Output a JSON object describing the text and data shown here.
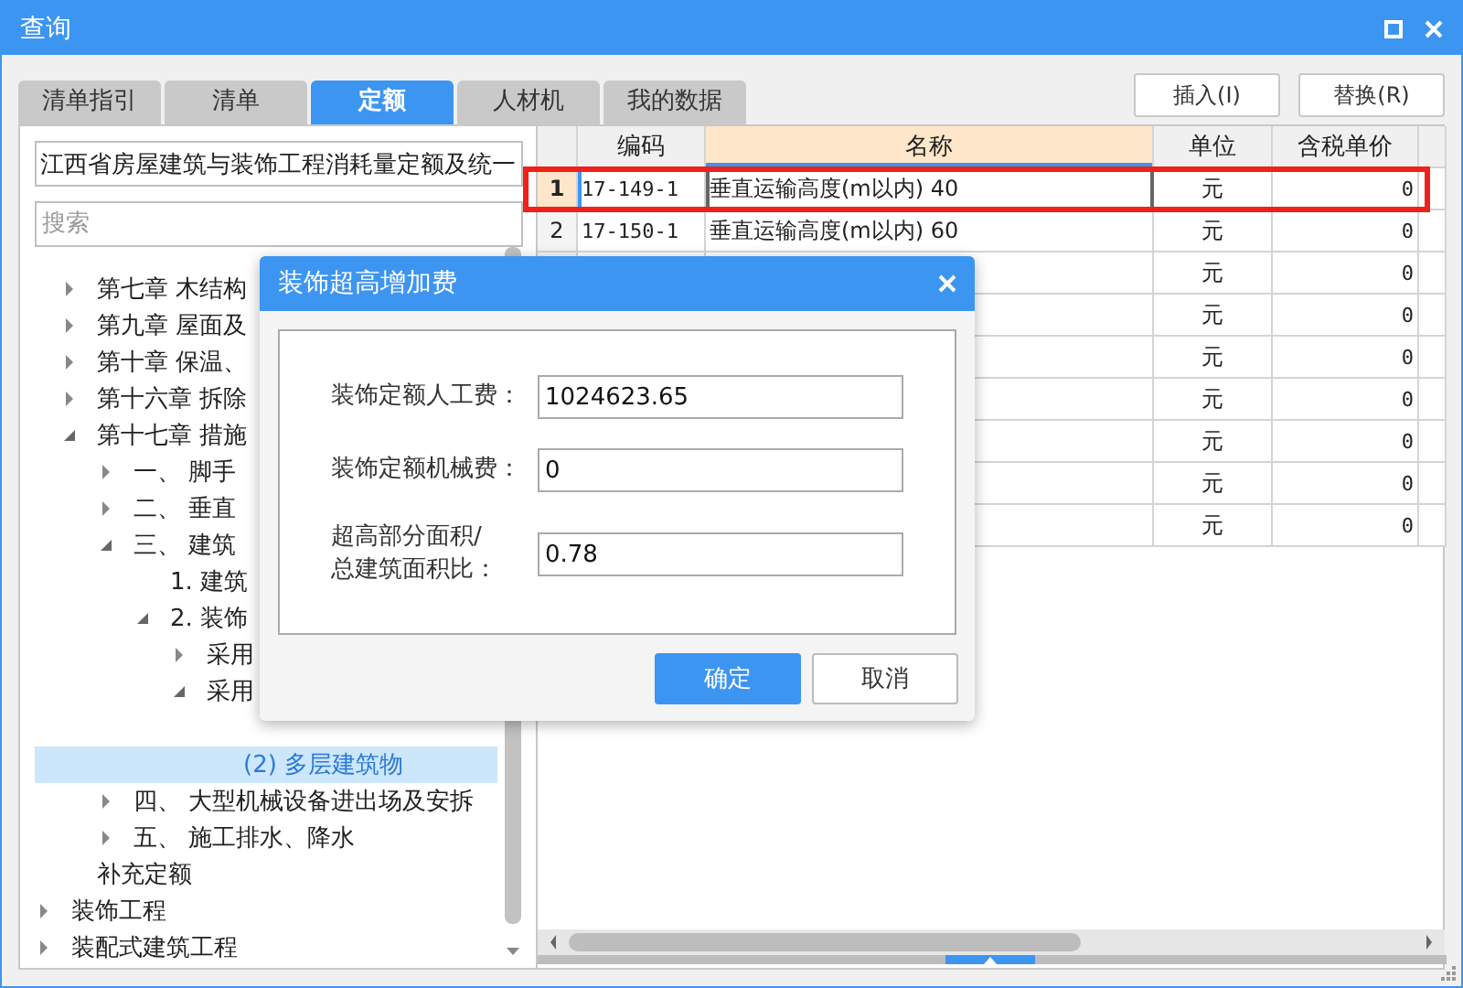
{
  "window": {
    "title": "查询"
  },
  "tabs": [
    {
      "label": "清单指引",
      "selected": false
    },
    {
      "label": "清单",
      "selected": false
    },
    {
      "label": "定额",
      "selected": true
    },
    {
      "label": "人材机",
      "selected": false
    },
    {
      "label": "我的数据",
      "selected": false
    }
  ],
  "buttons": [
    "插入(I)",
    "替换(R)"
  ],
  "library_select": {
    "value": "江西省房屋建筑与装饰工程消耗量定额及统一"
  },
  "search": {
    "placeholder": "搜索"
  },
  "tree": {
    "items": [
      {
        "kind": "hidden-parent",
        "children": [
          {
            "label": "第七章  木结构",
            "kind": "branch",
            "expanded": false,
            "selected": false
          },
          {
            "label": "第九章  屋面及",
            "kind": "branch",
            "expanded": false,
            "selected": false
          },
          {
            "label": "第十章  保温、",
            "kind": "branch",
            "expanded": false,
            "selected": false
          },
          {
            "label": "第十六章  拆除",
            "kind": "branch",
            "expanded": false,
            "selected": false
          },
          {
            "label": "第十七章  措施",
            "kind": "branch",
            "expanded": true,
            "selected": false,
            "children": [
              {
                "label": "一、  脚手",
                "kind": "branch",
                "expanded": false,
                "selected": false
              },
              {
                "label": "二、  垂直",
                "kind": "branch",
                "expanded": false,
                "selected": false
              },
              {
                "label": "三、  建筑",
                "kind": "branch",
                "expanded": true,
                "selected": false,
                "children": [
                  {
                    "label": "1.  建筑",
                    "kind": "leaf",
                    "selected": false
                  },
                  {
                    "label": "2.  装饰",
                    "kind": "branch",
                    "expanded": true,
                    "selected": false,
                    "children": [
                      {
                        "label": "采用",
                        "kind": "branch",
                        "expanded": false,
                        "selected": false
                      },
                      {
                        "label": "采用",
                        "kind": "branch",
                        "expanded": true,
                        "selected": false,
                        "children": [
                          {
                            "kind": "covered"
                          },
                          {
                            "label": "(2) 多层建筑物",
                            "kind": "leaf",
                            "selected": true
                          }
                        ]
                      }
                    ]
                  }
                ]
              },
              {
                "label": "四、  大型机械设备进出场及安拆",
                "kind": "branch",
                "expanded": false,
                "selected": false
              },
              {
                "label": "五、  施工排水、降水",
                "kind": "branch",
                "expanded": false,
                "selected": false
              }
            ]
          },
          {
            "label": "补充定额",
            "kind": "leaf",
            "selected": false
          }
        ]
      },
      {
        "label": "装饰工程",
        "kind": "branch",
        "expanded": false,
        "selected": false
      },
      {
        "label": "装配式建筑工程",
        "kind": "branch",
        "expanded": false,
        "selected": false
      }
    ]
  },
  "table": {
    "columns": [
      {
        "label": "编码",
        "selected": false
      },
      {
        "label": "名称",
        "selected": true
      },
      {
        "label": "单位",
        "selected": false
      },
      {
        "label": "含税单价",
        "selected": false
      }
    ],
    "rows": [
      {
        "number": "1",
        "code": "17-149-1",
        "name": "垂直运输高度(m以内) 40",
        "unit": "元",
        "price": "0",
        "selected": true,
        "outlined": true
      },
      {
        "number": "2",
        "code": "17-150-1",
        "name": "垂直运输高度(m以内) 60",
        "unit": "元",
        "price": "0",
        "selected": false
      },
      {
        "unit": "元",
        "price": "0"
      },
      {
        "unit": "元",
        "price": "0"
      },
      {
        "unit": "元",
        "price": "0"
      },
      {
        "unit": "元",
        "price": "0"
      },
      {
        "unit": "元",
        "price": "0"
      },
      {
        "unit": "元",
        "price": "0"
      },
      {
        "unit": "元",
        "price": "0"
      }
    ]
  },
  "dialog": {
    "title": "装饰超高增加费",
    "fields": [
      {
        "label": "装饰定额人工费：",
        "value": "1024623.65"
      },
      {
        "label": "装饰定额机械费：",
        "value": "0"
      },
      {
        "label": "超高部分面积/\n总建筑面积比：",
        "value": "0.78"
      }
    ],
    "buttons": [
      {
        "label": "确定",
        "kind": "primary"
      },
      {
        "label": "取消",
        "kind": "secondary"
      }
    ]
  }
}
